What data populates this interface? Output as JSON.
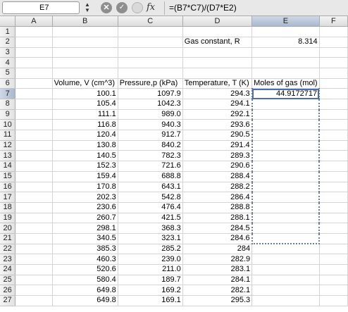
{
  "formula_bar": {
    "cell_ref": "E7",
    "cancel_icon": "cancel-icon",
    "enter_icon": "checkmark-icon",
    "fx_label": "fx",
    "formula": "=(B7*C7)/(D7*E2)"
  },
  "columns": [
    "A",
    "B",
    "C",
    "D",
    "E",
    "F"
  ],
  "selected_column": "E",
  "active_cell": "E7",
  "rows": [
    {
      "n": "1",
      "B": "",
      "C": "",
      "D": "",
      "E": "",
      "F": ""
    },
    {
      "n": "2",
      "B": "",
      "C": "",
      "D": "Gas constant, R",
      "E": "8.314",
      "F": ""
    },
    {
      "n": "3",
      "B": "",
      "C": "",
      "D": "",
      "E": "",
      "F": ""
    },
    {
      "n": "4",
      "B": "",
      "C": "",
      "D": "",
      "E": "",
      "F": ""
    },
    {
      "n": "5",
      "B": "",
      "C": "",
      "D": "",
      "E": "",
      "F": ""
    },
    {
      "n": "6",
      "B": "Volume, V (cm^3)",
      "C": "Pressure,p (kPa)",
      "D": "Temperature, T (K)",
      "E": "Moles of gas (mol)",
      "F": ""
    },
    {
      "n": "7",
      "B": "100.1",
      "C": "1097.9",
      "D": "294.3",
      "E": "44.9172717",
      "F": ""
    },
    {
      "n": "8",
      "B": "105.4",
      "C": "1042.3",
      "D": "294.1",
      "E": "",
      "F": ""
    },
    {
      "n": "9",
      "B": "111.1",
      "C": "989.0",
      "D": "292.1",
      "E": "",
      "F": ""
    },
    {
      "n": "10",
      "B": "116.8",
      "C": "940.3",
      "D": "293.6",
      "E": "",
      "F": ""
    },
    {
      "n": "11",
      "B": "120.4",
      "C": "912.7",
      "D": "290.5",
      "E": "",
      "F": ""
    },
    {
      "n": "12",
      "B": "130.8",
      "C": "840.2",
      "D": "291.4",
      "E": "",
      "F": ""
    },
    {
      "n": "13",
      "B": "140.5",
      "C": "782.3",
      "D": "289.3",
      "E": "",
      "F": ""
    },
    {
      "n": "14",
      "B": "152.3",
      "C": "721.6",
      "D": "290.6",
      "E": "",
      "F": ""
    },
    {
      "n": "15",
      "B": "159.4",
      "C": "688.8",
      "D": "288.4",
      "E": "",
      "F": ""
    },
    {
      "n": "16",
      "B": "170.8",
      "C": "643.1",
      "D": "288.2",
      "E": "",
      "F": ""
    },
    {
      "n": "17",
      "B": "202.3",
      "C": "542.8",
      "D": "286.4",
      "E": "",
      "F": ""
    },
    {
      "n": "18",
      "B": "230.6",
      "C": "476.4",
      "D": "288.8",
      "E": "",
      "F": ""
    },
    {
      "n": "19",
      "B": "260.7",
      "C": "421.5",
      "D": "288.1",
      "E": "",
      "F": ""
    },
    {
      "n": "20",
      "B": "298.1",
      "C": "368.3",
      "D": "284.5",
      "E": "",
      "F": ""
    },
    {
      "n": "21",
      "B": "340.5",
      "C": "323.1",
      "D": "284.6",
      "E": "",
      "F": ""
    },
    {
      "n": "22",
      "B": "385.3",
      "C": "285.2",
      "D": "284",
      "E": "",
      "F": ""
    },
    {
      "n": "23",
      "B": "460.3",
      "C": "239.0",
      "D": "282.9",
      "E": "",
      "F": ""
    },
    {
      "n": "24",
      "B": "520.6",
      "C": "211.0",
      "D": "283.1",
      "E": "",
      "F": ""
    },
    {
      "n": "25",
      "B": "580.4",
      "C": "189.7",
      "D": "284.1",
      "E": "",
      "F": ""
    },
    {
      "n": "26",
      "B": "649.8",
      "C": "169.2",
      "D": "282.1",
      "E": "",
      "F": ""
    },
    {
      "n": "27",
      "B": "649.8",
      "C": "169.1",
      "D": "295.3",
      "E": "",
      "F": ""
    }
  ]
}
